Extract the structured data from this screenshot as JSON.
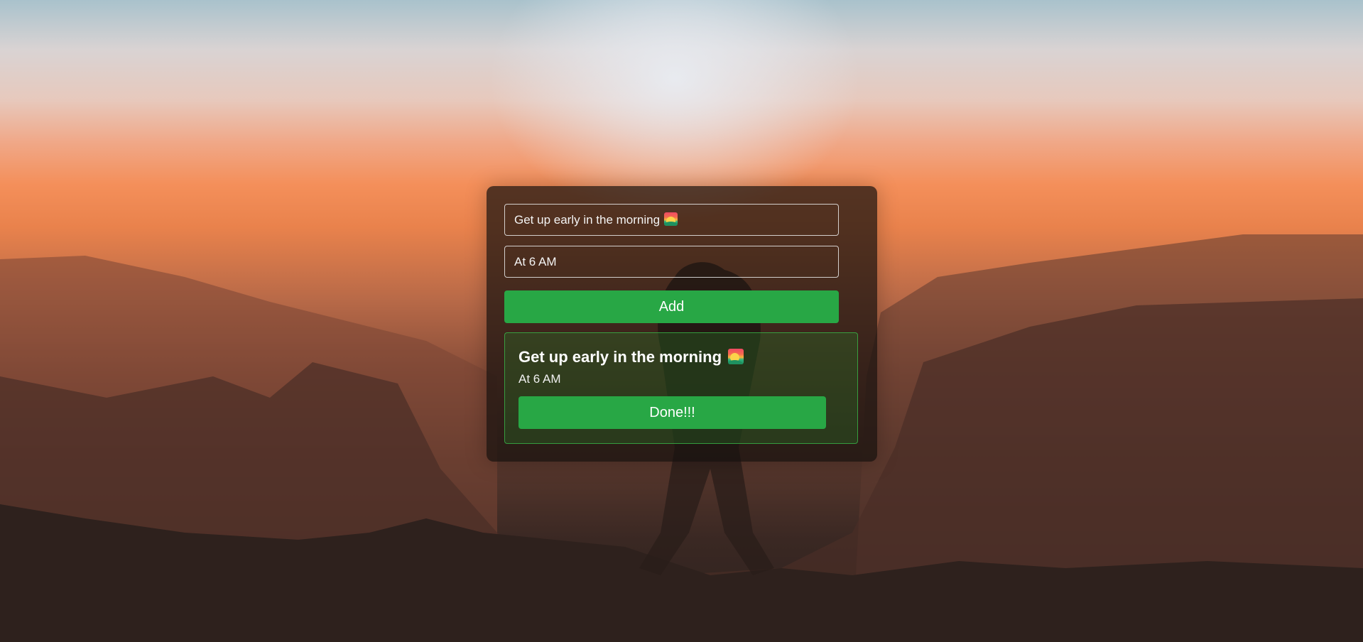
{
  "form": {
    "task_value": "Get up early in the morning",
    "time_value": "At 6 AM",
    "add_label": "Add"
  },
  "todo": {
    "title": "Get up early in the morning",
    "time": "At 6 AM",
    "done_label": "Done!!!"
  },
  "icons": {
    "task_emoji": "sunrise-over-mountains-icon"
  },
  "colors": {
    "accent_green": "#28a745",
    "todo_border": "#3cc850",
    "card_bg": "#16100e"
  }
}
